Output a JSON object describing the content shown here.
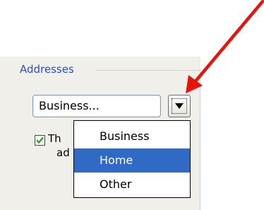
{
  "addresses_group": {
    "label": "Addresses"
  },
  "address_type_combo": {
    "value": "Business...",
    "arrow_icon": "chevron-down-icon"
  },
  "mailing_checkbox": {
    "checked": true,
    "label_line1": "Th",
    "label_line2": "ad"
  },
  "dropdown": {
    "options": [
      {
        "label": "Business",
        "selected": false
      },
      {
        "label": "Home",
        "selected": true
      },
      {
        "label": "Other",
        "selected": false
      }
    ],
    "highlight_color": "#316ac5"
  },
  "annotation": {
    "icon": "red-arrow-icon",
    "color": "#e8140c"
  }
}
